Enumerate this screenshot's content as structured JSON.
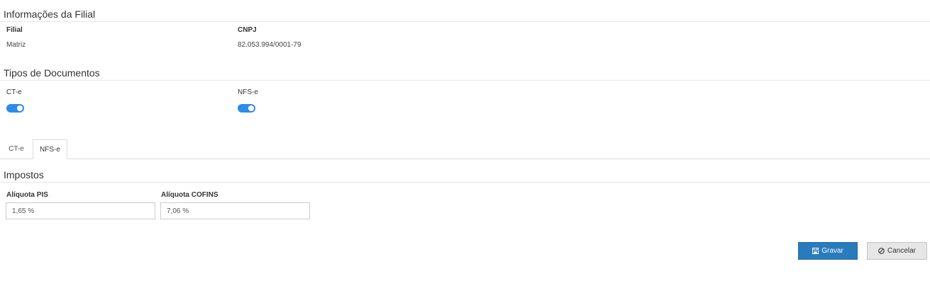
{
  "filial_section": {
    "title": "Informações da Filial",
    "filial_label": "Filial",
    "cnpj_label": "CNPJ",
    "filial_value": "Matriz",
    "cnpj_value": "82.053.994/0001-79"
  },
  "documentos_section": {
    "title": "Tipos de Documentos",
    "cte_label": "CT-e",
    "nfse_label": "NFS-e",
    "cte_enabled": true,
    "nfse_enabled": true
  },
  "tabs": [
    {
      "label": "CT-e",
      "active": false
    },
    {
      "label": "NFS-e",
      "active": true
    }
  ],
  "impostos_section": {
    "title": "Impostos",
    "pis_label": "Alíquota PIS",
    "pis_value": "1,65 %",
    "cofins_label": "Alíquota COFINS",
    "cofins_value": "7,06 %"
  },
  "actions": {
    "save_label": "Gravar",
    "cancel_label": "Cancelar"
  },
  "colors": {
    "toggle_on": "#2d8ce8",
    "primary_button": "#2a7bbd",
    "default_button": "#e6e6e6"
  }
}
